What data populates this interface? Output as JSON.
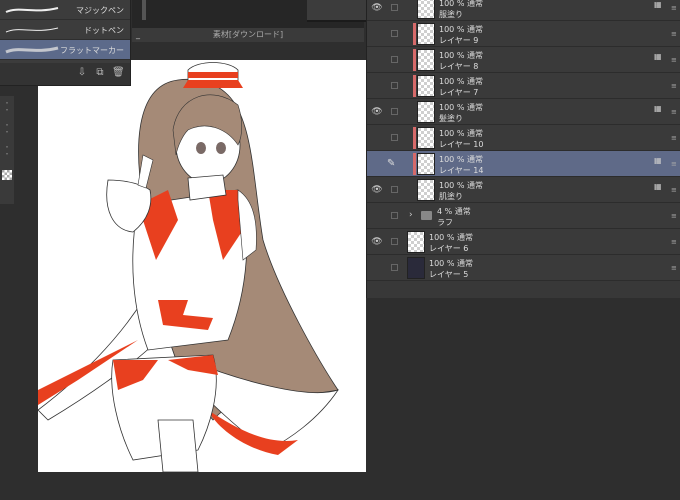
{
  "canvas": {
    "title": "素材[ダウンロード]",
    "minimize_label": "_"
  },
  "brushes": [
    {
      "name": "マジックペン",
      "selected": false
    },
    {
      "name": "ドットペン",
      "selected": false
    },
    {
      "name": "フラットマーカー",
      "selected": true
    }
  ],
  "brush_tools": [
    {
      "icon": "import-icon",
      "glyph": "⇩"
    },
    {
      "icon": "duplicate-icon",
      "glyph": "⧉"
    },
    {
      "icon": "trash-icon",
      "glyph": "🗑"
    }
  ],
  "layers": [
    {
      "mode": "100 % 通常",
      "name": "服塗り",
      "eye": true,
      "clip": false,
      "indent": 1,
      "selected": false,
      "icon": true
    },
    {
      "mode": "100 % 通常",
      "name": "レイヤー 9",
      "eye": false,
      "clip": true,
      "indent": 1,
      "selected": false,
      "icon": false
    },
    {
      "mode": "100 % 通常",
      "name": "レイヤー 8",
      "eye": false,
      "clip": true,
      "indent": 1,
      "selected": false,
      "icon": true
    },
    {
      "mode": "100 % 通常",
      "name": "レイヤー 7",
      "eye": false,
      "clip": true,
      "indent": 1,
      "selected": false,
      "icon": false
    },
    {
      "mode": "100 % 通常",
      "name": "髪塗り",
      "eye": true,
      "clip": false,
      "indent": 1,
      "selected": false,
      "icon": true
    },
    {
      "mode": "100 % 通常",
      "name": "レイヤー 10",
      "eye": false,
      "clip": true,
      "indent": 1,
      "selected": false,
      "icon": false
    },
    {
      "mode": "100 % 通常",
      "name": "レイヤー 14",
      "eye": false,
      "clip": true,
      "indent": 1,
      "selected": true,
      "icon": true,
      "pen": true
    },
    {
      "mode": "100 % 通常",
      "name": "肌塗り",
      "eye": true,
      "clip": false,
      "indent": 1,
      "selected": false,
      "icon": true
    },
    {
      "mode": "4 % 通常",
      "name": "ラフ",
      "eye": false,
      "clip": false,
      "indent": 0,
      "selected": false,
      "icon": false,
      "folder": true
    },
    {
      "mode": "100 % 通常",
      "name": "レイヤー 6",
      "eye": true,
      "clip": false,
      "indent": 0,
      "selected": false,
      "icon": false
    },
    {
      "mode": "100 % 通常",
      "name": "レイヤー 5",
      "eye": false,
      "clip": false,
      "indent": 0,
      "selected": false,
      "icon": false,
      "dark": true
    }
  ],
  "colors": {
    "accent_selected": "#5f6a88",
    "clip_marker": "#d66a6a",
    "costume_red": "#e8401f",
    "hair": "#a58a77"
  }
}
